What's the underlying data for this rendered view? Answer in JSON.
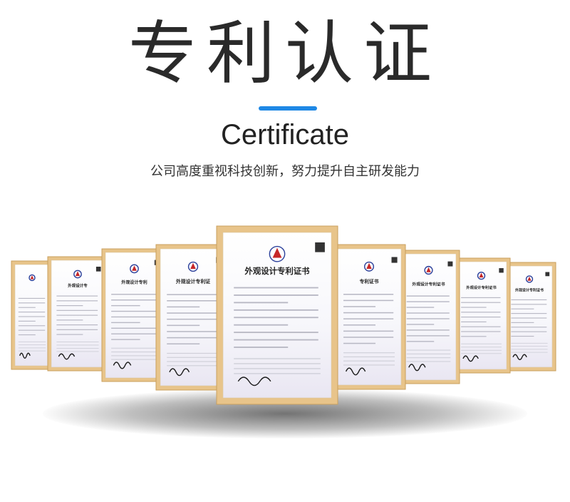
{
  "header": {
    "title": "专利认证",
    "subtitle": "Certificate",
    "tagline": "公司高度重视科技创新，努力提升自主研发能力",
    "accent_color": "#1e88e5"
  },
  "certificates": {
    "frame_color": "#e8c48a",
    "items": [
      {
        "title": ""
      },
      {
        "title": "外观设计专"
      },
      {
        "title": "外观设计专利"
      },
      {
        "title": "外观设计专利证"
      },
      {
        "title": "外观设计专利证书"
      },
      {
        "title": "专利证书"
      },
      {
        "title": "外观设计专利证书"
      },
      {
        "title": "外观设计专利证书"
      },
      {
        "title": "外观设计专利证书"
      }
    ]
  }
}
